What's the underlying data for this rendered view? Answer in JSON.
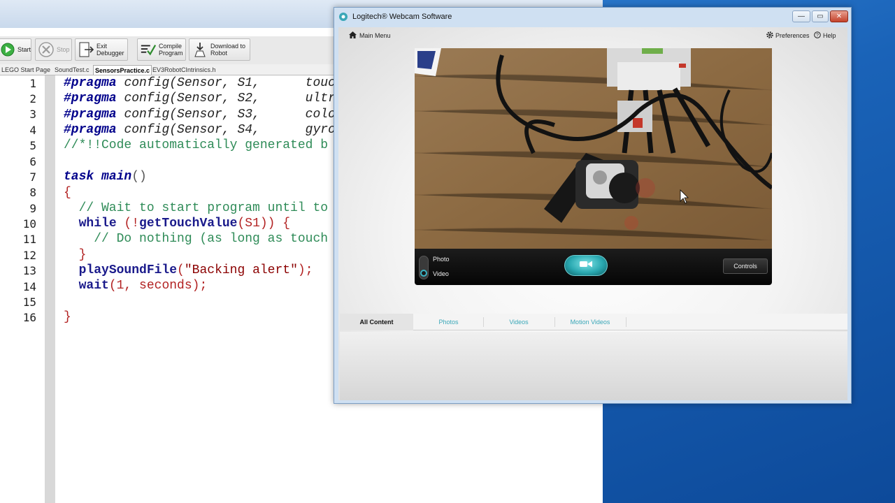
{
  "ide": {
    "toolbar": {
      "start": "Start",
      "stop": "Stop",
      "exit_debugger": [
        "Exit",
        "Debugger"
      ],
      "compile": [
        "Compile",
        "Program"
      ],
      "download": [
        "Download to",
        "Robot"
      ]
    },
    "file_tabs": [
      "LEGO Start Page",
      "SoundTest.c",
      "SensorsPractice.c",
      "EV3RobotCIntrinsics.h"
    ],
    "active_tab": "SensorsPractice.c",
    "line_numbers": [
      "1",
      "2",
      "3",
      "4",
      "5",
      "6",
      "7",
      "8",
      "9",
      "10",
      "11",
      "12",
      "13",
      "14",
      "15",
      "16"
    ],
    "code": {
      "l1": [
        "#pragma",
        "config",
        "(Sensor, S1,      touc"
      ],
      "l2": [
        "#pragma",
        "config",
        "(Sensor, S2,      ultr"
      ],
      "l3": [
        "#pragma",
        "config",
        "(Sensor, S3,      colo"
      ],
      "l4": [
        "#pragma",
        "config",
        "(Sensor, S4,      gyro"
      ],
      "l5": "//*!!Code automatically generated b",
      "l7": [
        "task",
        "main",
        "()"
      ],
      "l8": "{",
      "l9": "  // Wait to start program until to",
      "l10": [
        "  ",
        "while",
        " (!",
        "getTouchValue",
        "(S1)) {"
      ],
      "l11": "    // Do nothing (as long as touch",
      "l12": "  }",
      "l13": [
        "  ",
        "playSoundFile",
        "(",
        "\"Backing alert\"",
        ");"
      ],
      "l14": [
        "  ",
        "wait",
        "(1, seconds);"
      ],
      "l16": "}"
    }
  },
  "logitech": {
    "title": "Logitech® Webcam Software",
    "window_buttons": {
      "minimize": "—",
      "maximize": "▭",
      "close": "✕"
    },
    "main_menu": "Main Menu",
    "preferences": "Preferences",
    "help": "Help",
    "mode": {
      "photo": "Photo",
      "video": "Video",
      "selected": "Video"
    },
    "controls": "Controls",
    "tabs": [
      "All Content",
      "Photos",
      "Videos",
      "Motion Videos"
    ],
    "active_tab": "All Content",
    "accent_color": "#3aa7b8"
  }
}
